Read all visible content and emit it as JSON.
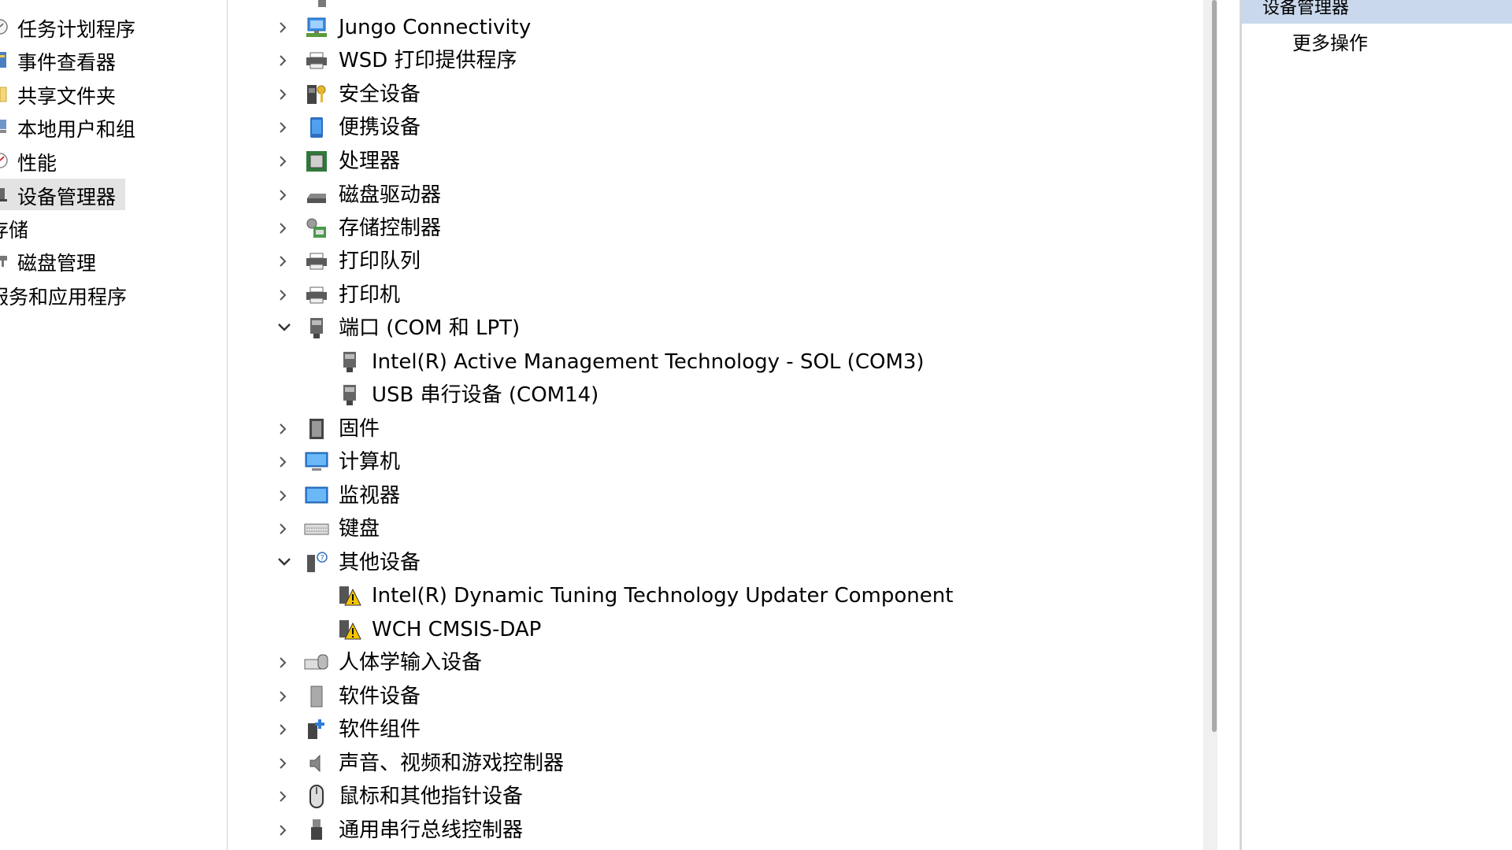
{
  "left_nav": {
    "items": [
      {
        "label": "任务计划程序",
        "icon": "task-scheduler-icon"
      },
      {
        "label": "事件查看器",
        "icon": "event-viewer-icon"
      },
      {
        "label": "共享文件夹",
        "icon": "shared-folder-icon"
      },
      {
        "label": "本地用户和组",
        "icon": "users-groups-icon"
      },
      {
        "label": "性能",
        "icon": "performance-icon"
      },
      {
        "label": "设备管理器",
        "icon": "device-manager-icon",
        "selected": true
      },
      {
        "label": "存储",
        "icon": "storage-icon"
      },
      {
        "label": "磁盘管理",
        "icon": "disk-management-icon"
      },
      {
        "label": "服务和应用程序",
        "icon": "services-apps-icon"
      }
    ]
  },
  "tree": {
    "rows": [
      {
        "label": "Jungo Connectivity",
        "icon": "network-icon",
        "expanded": false
      },
      {
        "label": "WSD 打印提供程序",
        "icon": "printer-icon",
        "expanded": false
      },
      {
        "label": "安全设备",
        "icon": "security-device-icon",
        "expanded": false
      },
      {
        "label": "便携设备",
        "icon": "portable-device-icon",
        "expanded": false
      },
      {
        "label": "处理器",
        "icon": "processor-icon",
        "expanded": false
      },
      {
        "label": "磁盘驱动器",
        "icon": "disk-drive-icon",
        "expanded": false
      },
      {
        "label": "存储控制器",
        "icon": "storage-controller-icon",
        "expanded": false
      },
      {
        "label": "打印队列",
        "icon": "printer-icon",
        "expanded": false
      },
      {
        "label": "打印机",
        "icon": "printer-icon",
        "expanded": false
      },
      {
        "label": "端口 (COM 和 LPT)",
        "icon": "port-icon",
        "expanded": true
      },
      {
        "label": "Intel(R) Active Management Technology - SOL (COM3)",
        "icon": "port-icon",
        "child": true
      },
      {
        "label": "USB 串行设备 (COM14)",
        "icon": "port-icon",
        "child": true
      },
      {
        "label": "固件",
        "icon": "firmware-icon",
        "expanded": false
      },
      {
        "label": "计算机",
        "icon": "computer-icon",
        "expanded": false
      },
      {
        "label": "监视器",
        "icon": "monitor-icon",
        "expanded": false
      },
      {
        "label": "键盘",
        "icon": "keyboard-icon",
        "expanded": false
      },
      {
        "label": "其他设备",
        "icon": "other-devices-icon",
        "expanded": true
      },
      {
        "label": "Intel(R) Dynamic Tuning Technology Updater Component",
        "icon": "warning-device-icon",
        "child": true
      },
      {
        "label": "WCH CMSIS-DAP",
        "icon": "warning-device-icon",
        "child": true
      },
      {
        "label": "人体学输入设备",
        "icon": "hid-icon",
        "expanded": false
      },
      {
        "label": "软件设备",
        "icon": "software-device-icon",
        "expanded": false
      },
      {
        "label": "软件组件",
        "icon": "software-component-icon",
        "expanded": false
      },
      {
        "label": "声音、视频和游戏控制器",
        "icon": "audio-icon",
        "expanded": false
      },
      {
        "label": "鼠标和其他指针设备",
        "icon": "mouse-icon",
        "expanded": false
      },
      {
        "label": "通用串行总线控制器",
        "icon": "usb-icon",
        "expanded": false
      }
    ]
  },
  "actions": {
    "header": "设备管理器",
    "more_actions": "更多操作"
  }
}
